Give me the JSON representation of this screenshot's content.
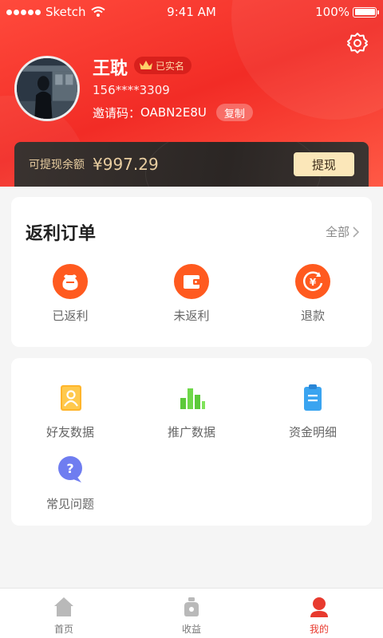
{
  "status_bar": {
    "carrier": "Sketch",
    "time": "9:41 AM",
    "battery": "100%"
  },
  "profile": {
    "name": "王耽",
    "verified_label": "已实名",
    "phone": "156****3309",
    "invite_label": "邀请码：",
    "invite_code": "OABN2E8U",
    "copy_label": "复制"
  },
  "balance": {
    "label": "可提现余额",
    "amount": "¥997.29",
    "withdraw_label": "提现"
  },
  "orders": {
    "title": "返利订单",
    "see_all": "全部",
    "items": [
      {
        "label": "已返利",
        "icon": "bag-icon"
      },
      {
        "label": "未返利",
        "icon": "wallet-icon"
      },
      {
        "label": "退款",
        "icon": "refund-icon"
      }
    ]
  },
  "tools": {
    "items": [
      {
        "label": "好友数据",
        "icon": "friend-card-icon"
      },
      {
        "label": "推广数据",
        "icon": "bar-chart-icon"
      },
      {
        "label": "资金明细",
        "icon": "clipboard-icon"
      },
      {
        "label": "常见问题",
        "icon": "question-bubble-icon"
      }
    ]
  },
  "tabbar": {
    "items": [
      {
        "label": "首页",
        "icon": "home-icon"
      },
      {
        "label": "收益",
        "icon": "money-bag-icon"
      },
      {
        "label": "我的",
        "icon": "person-icon"
      }
    ],
    "active_index": 2
  },
  "colors": {
    "primary": "#f22c26",
    "accent_gold": "#e8cda0",
    "tab_active": "#e83a2e"
  }
}
